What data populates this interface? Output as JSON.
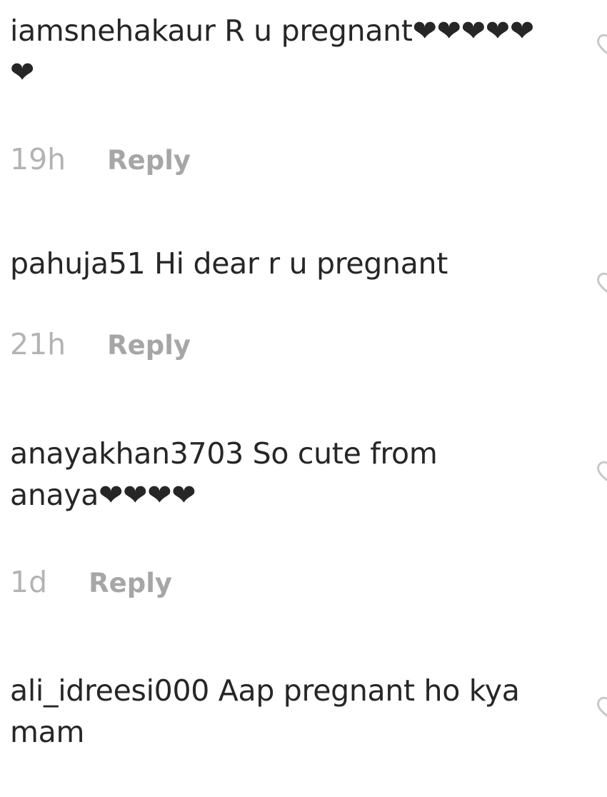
{
  "comments": [
    {
      "username": "iamsnehakaur",
      "text": "R u pregnant❤❤❤❤❤❤",
      "time": "19h",
      "reply_label": "Reply"
    },
    {
      "username": "pahuja51",
      "text": "Hi dear r u pregnant",
      "time": "21h",
      "reply_label": "Reply"
    },
    {
      "username": "anayakhan3703",
      "text": "So cute from anaya❤❤❤❤",
      "time": "1d",
      "reply_label": "Reply"
    },
    {
      "username": "ali_idreesi000",
      "text": "Aap pregnant ho kya mam",
      "time": "",
      "reply_label": ""
    }
  ],
  "icons": {
    "like": "heart-outline-icon"
  }
}
